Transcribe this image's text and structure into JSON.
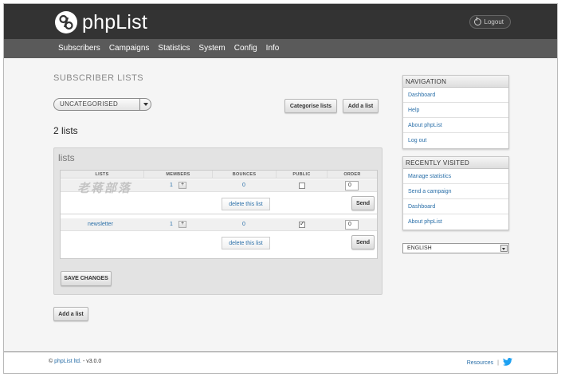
{
  "app": {
    "name": "phpList"
  },
  "header": {
    "logout_label": "Logout"
  },
  "nav": {
    "items": [
      "Subscribers",
      "Campaigns",
      "Statistics",
      "System",
      "Config",
      "Info"
    ]
  },
  "page": {
    "title": "SUBSCRIBER LISTS",
    "category_select": {
      "selected": "UNCATEGORISED"
    },
    "categorise_button": "Categorise lists",
    "add_list_button": "Add a list",
    "list_count": "2 lists"
  },
  "lists_panel": {
    "title": "lists",
    "columns": [
      "LISTS",
      "MEMBERS",
      "BOUNCES",
      "PUBLIC",
      "ORDER"
    ],
    "rows": [
      {
        "name": "",
        "members": "1",
        "bounces": "0",
        "public": false,
        "order": "0",
        "delete_label": "delete this list",
        "send_label": "Send"
      },
      {
        "name": "newsletter",
        "members": "1",
        "bounces": "0",
        "public": true,
        "order": "0",
        "delete_label": "delete this list",
        "send_label": "Send"
      }
    ],
    "expand_symbol": "+",
    "save_button": "SAVE CHANGES"
  },
  "bottom_add_button": "Add a list",
  "watermark": "老蒋部落",
  "sidebar": {
    "navigation": {
      "title": "NAVIGATION",
      "items": [
        "Dashboard",
        "Help",
        "About phpList",
        "Log out"
      ]
    },
    "recent": {
      "title": "RECENTLY VISITED",
      "items": [
        "Manage statistics",
        "Send a campaign",
        "Dashboard",
        "About phpList"
      ]
    },
    "language": {
      "selected": "ENGLISH"
    }
  },
  "footer": {
    "copyright_symbol": "©",
    "company": "phpList ltd.",
    "version": "- v3.0.0",
    "resources": "Resources",
    "separator": "|"
  },
  "colors": {
    "header": "#333333",
    "navbar": "#5a5a5a",
    "link": "#2a6fa8",
    "twitter": "#1da1f2"
  }
}
